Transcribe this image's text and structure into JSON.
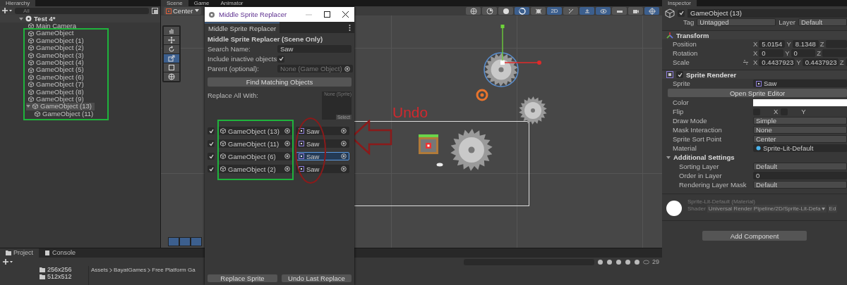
{
  "hierarchy": {
    "tab": "Hierarchy",
    "search_placeholder": "All",
    "scene": "Test 4*",
    "items": [
      {
        "label": "Main Camera",
        "selected": false
      },
      {
        "label": "GameObject",
        "selected": false
      },
      {
        "label": "GameObject (1)",
        "selected": false
      },
      {
        "label": "GameObject (2)",
        "selected": false
      },
      {
        "label": "GameObject (3)",
        "selected": false
      },
      {
        "label": "GameObject (4)",
        "selected": false
      },
      {
        "label": "GameObject (5)",
        "selected": false
      },
      {
        "label": "GameObject (6)",
        "selected": false
      },
      {
        "label": "GameObject (7)",
        "selected": false
      },
      {
        "label": "GameObject (8)",
        "selected": false
      },
      {
        "label": "GameObject (9)",
        "selected": false
      },
      {
        "label": "GameObject (13)",
        "selected": true,
        "expanded": true,
        "children": [
          {
            "label": "GameObject (11)",
            "selected": false
          }
        ]
      }
    ]
  },
  "scene_view": {
    "tabs": [
      {
        "label": "Scene",
        "selected": true
      },
      {
        "label": "Game",
        "selected": false
      },
      {
        "label": "Animator",
        "selected": false
      }
    ],
    "pivot": "Center",
    "view_buttons": [
      {
        "selected": false
      },
      {
        "selected": false
      },
      {
        "selected": false
      },
      {
        "selected": true
      },
      {
        "selected": false
      },
      {
        "label": "2D",
        "selected": true
      },
      {
        "selected": false
      },
      {
        "selected": true
      },
      {
        "selected": true
      },
      {
        "selected": false
      },
      {
        "selected": false
      },
      {
        "selected": true
      }
    ],
    "tools": [
      {
        "selected": false
      },
      {
        "selected": false
      },
      {
        "selected": false
      },
      {
        "selected": true
      },
      {
        "selected": false
      },
      {
        "selected": false
      }
    ],
    "annotation": "Undo"
  },
  "replacer_window": {
    "title": "Middle Sprite Replacer",
    "tab": "Middle Sprite Replacer",
    "heading": "Middle Sprite Replacer (Scene Only)",
    "fields": [
      {
        "kind": "text",
        "label": "Search Name:",
        "value": "Saw"
      },
      {
        "kind": "checkbox",
        "label": "Include inactive objects",
        "checked": true
      },
      {
        "kind": "object",
        "label": "Parent (optional):",
        "value": "None (Game Object)"
      }
    ],
    "find_button": "Find Matching Objects",
    "replace_all_label": "Replace All With:",
    "sprite_slot": {
      "value": "None (Sprite)",
      "button": "Select"
    },
    "rows": [
      {
        "checked": true,
        "object": "GameObject (13)",
        "sprite": "Saw",
        "focused": false
      },
      {
        "checked": true,
        "object": "GameObject (11)",
        "sprite": "Saw",
        "focused": false
      },
      {
        "checked": true,
        "object": "GameObject (6)",
        "sprite": "Saw",
        "focused": true
      },
      {
        "checked": true,
        "object": "GameObject (2)",
        "sprite": "Saw",
        "focused": false
      }
    ],
    "buttons": [
      "Replace Sprite",
      "Undo Last Replace"
    ]
  },
  "inspector": {
    "tab": "Inspector",
    "object_name": "GameObject (13)",
    "active": true,
    "tag_label": "Tag",
    "tag": "Untagged",
    "layer_label": "Layer",
    "layer": "Default",
    "transform": {
      "title": "Transform",
      "rows": [
        {
          "label": "Position",
          "values": [
            {
              "axis": "X",
              "value": "5.0154"
            },
            {
              "axis": "Y",
              "value": "8.1348"
            },
            {
              "axis": "Z"
            }
          ]
        },
        {
          "label": "Rotation",
          "values": [
            {
              "axis": "X",
              "value": "0"
            },
            {
              "axis": "Y",
              "value": "0"
            },
            {
              "axis": "Z"
            }
          ]
        },
        {
          "label": "Scale",
          "linked": true,
          "values": [
            {
              "axis": "X",
              "value": "0.4437923"
            },
            {
              "axis": "Y",
              "value": "0.4437923"
            },
            {
              "axis": "Z"
            }
          ]
        }
      ]
    },
    "sprite_renderer": {
      "title": "Sprite Renderer",
      "enabled": true,
      "props": [
        {
          "kind": "object",
          "label": "Sprite",
          "value": "Saw"
        },
        {
          "kind": "button",
          "value": "Open Sprite Editor"
        },
        {
          "kind": "color",
          "label": "Color",
          "color": "#ffffff"
        },
        {
          "kind": "flip",
          "label": "Flip",
          "options": [
            {
              "label": "X",
              "checked": false
            },
            {
              "label": "Y",
              "checked": false
            }
          ]
        },
        {
          "kind": "dropdown",
          "label": "Draw Mode",
          "value": "Simple"
        },
        {
          "kind": "dropdown",
          "label": "Mask Interaction",
          "value": "None"
        },
        {
          "kind": "dropdown",
          "label": "Sprite Sort Point",
          "value": "Center"
        },
        {
          "kind": "material",
          "label": "Material",
          "value": "Sprite-Lit-Default"
        },
        {
          "kind": "foldout",
          "label": "Additional Settings",
          "expanded": true,
          "children": [
            {
              "kind": "dropdown",
              "label": "Sorting Layer",
              "value": "Default"
            },
            {
              "kind": "text",
              "label": "Order in Layer",
              "value": "0"
            },
            {
              "kind": "dropdown",
              "label": "Rendering Layer Mask",
              "value": "Default"
            }
          ]
        }
      ]
    },
    "material": {
      "name": "Sprite-Lit-Default (Material)",
      "shader_label": "Shader",
      "shader": "Universal Render Pipeline/2D/Sprite-Lit-Defa",
      "edit": "Ed"
    },
    "add_component": "Add Component"
  },
  "project": {
    "tabs": [
      {
        "label": "Project",
        "selected": true
      },
      {
        "label": "Console",
        "selected": false
      }
    ],
    "folders": [
      "256x256",
      "512x512"
    ],
    "breadcrumb": [
      "Assets",
      "BayatGames",
      "Free Platform Ga"
    ],
    "count": "29"
  }
}
